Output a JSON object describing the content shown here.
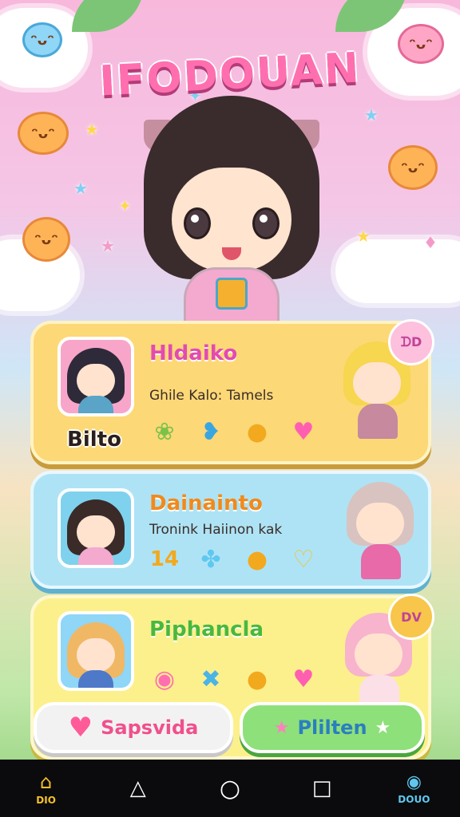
{
  "app": {
    "title": "IFODOUAN",
    "brand_colors": {
      "title": "#ff6fb0",
      "card1": "#fcd877",
      "card2": "#aee3f5",
      "card3": "#fcf08c"
    }
  },
  "cards": [
    {
      "name": "Hldaiko",
      "name_color": "#e24bb0",
      "subtitle": "Ghile Kalo: Tamels",
      "badge_label": "Bilto",
      "corner_tag": "ᗪD",
      "icons": [
        "sprout-icon",
        "bird-icon",
        "lemon-icon",
        "heart-icon"
      ]
    },
    {
      "name": "Dainainto",
      "name_color": "#f08a1d",
      "subtitle": "Tronink Haiinon kak",
      "icons": [
        "number-14-icon",
        "clover-icon",
        "lemon-icon",
        "heart-icon"
      ]
    },
    {
      "name": "Piphancla",
      "name_color": "#49b83e",
      "corner_tag": "DV",
      "icons": [
        "bubble-icon",
        "star-x-icon",
        "lemon-icon",
        "heart-icon"
      ]
    }
  ],
  "buttons": {
    "left_label": "Sapsvida",
    "right_label": "Plilten"
  },
  "navbar": {
    "home_label": "DIO",
    "right_label": "DOUO"
  }
}
